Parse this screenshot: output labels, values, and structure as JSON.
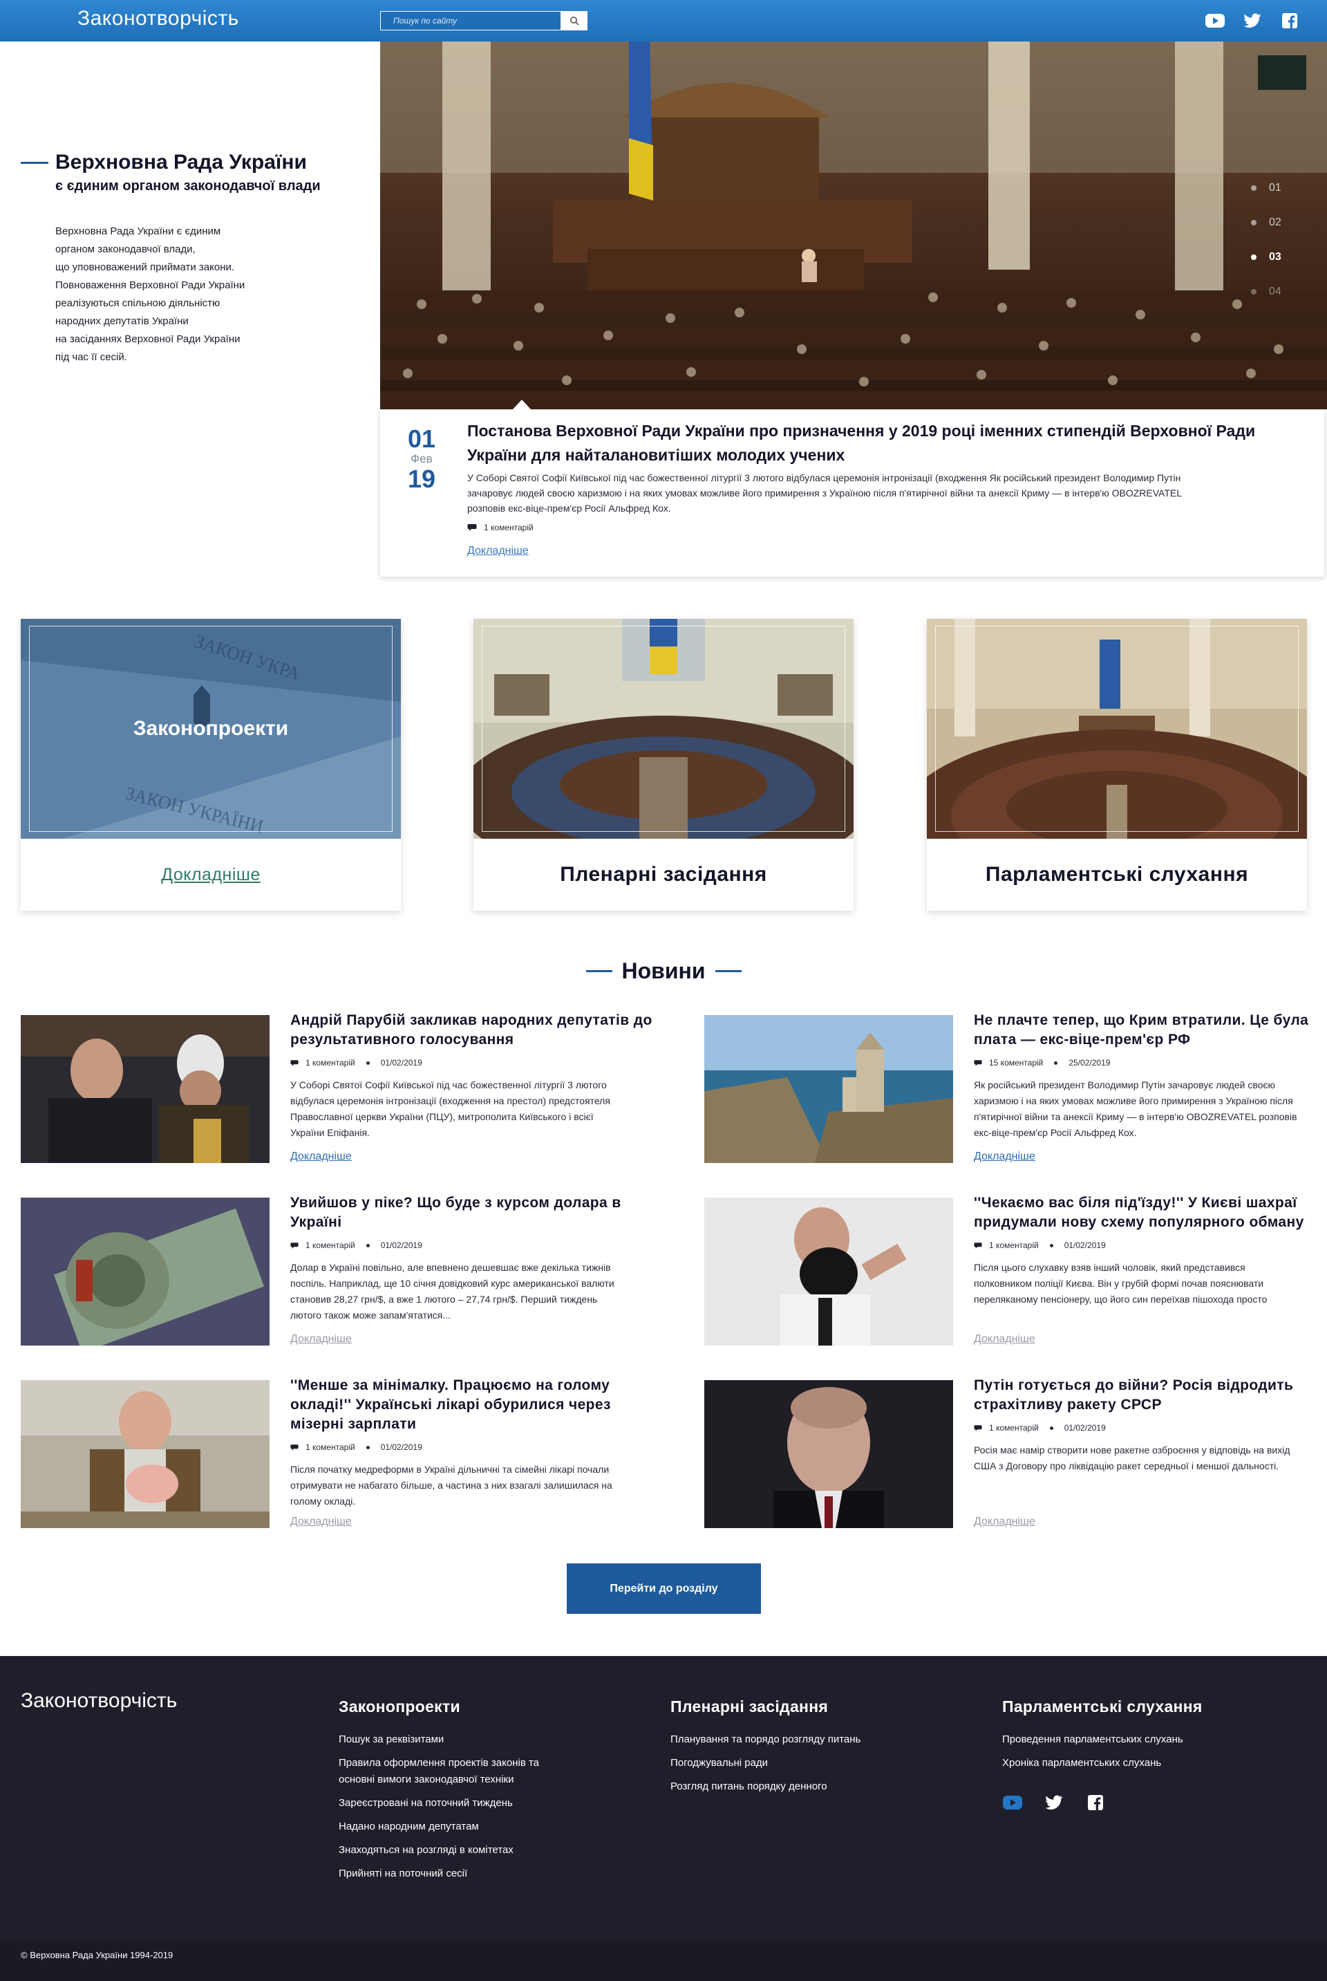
{
  "header": {
    "logo": "Законотворчість",
    "search_placeholder": "Пошук по сайту",
    "social": [
      "youtube-icon",
      "twitter-icon",
      "facebook-icon"
    ]
  },
  "hero": {
    "title": "Верхновна Рада України",
    "subtitle": "є єдиним органом законодавчої влади",
    "text_lines": [
      "Верхновна Рада України є єдиним",
      "органом законодавчої влади,",
      "що уповноважений приймати закони.",
      "Повноваження Верховної Ради України",
      "реалізуються спільною діяльністю",
      "народних депутатів України",
      "на засіданнях Верховної Ради України",
      "під час її сесій."
    ],
    "slider": [
      "01",
      "02",
      "03",
      "04"
    ],
    "slider_active": 2
  },
  "featured": {
    "day": "01",
    "month": "Фев",
    "year": "19",
    "title": "Постанова Верховної Ради України про призначення у 2019 році іменних стипендій Верховної Ради України для найталановитіших молодих учених",
    "excerpt": "У Соборі Святої Софії Київської під час божественної літургії 3 лютого відбулася церемонія інтронізації (входження Як російський президент Володимир Путін зачаровує людей своєю харизмою і на яких умовах можливе його примирення з Україною після п'ятирічної війни та анексії Криму — в інтерв'ю OBOZREVATEL розповів екс-віце-прем'єр Росії Альфред Кох.",
    "comments": "1 коментарій",
    "more": "Докладніше"
  },
  "categories": [
    {
      "label": "Законопроекти",
      "more": "Докладніше"
    },
    {
      "label": "Пленарні засідання"
    },
    {
      "label": "Парламентські слухання"
    }
  ],
  "news_heading": "Новини",
  "news": [
    {
      "title": "Андрій Парубій закликав народних депутатів до результативного голосування",
      "comments": "1 коментарій",
      "date": "01/02/2019",
      "text": "У Соборі Святої Софії Київської під час божественної літургії 3 лютого відбулася церемонія інтронізації (входження на престол) предстоятеля Православної церкви України (ПЦУ), митрополита Київського і всієї України Епіфанія.",
      "more": "Докладніше"
    },
    {
      "title": "Не плачте тепер, що Крим втратили. Це була плата — екс-віце-прем'єр РФ",
      "comments": "15 коментарій",
      "date": "25/02/2019",
      "text": "Як російський президент Володимир Путін зачаровує людей своєю харизмою і на яких умовах можливе його примирення з Україною після п'ятирічної війни та анексії Криму — в інтерв'ю OBOZREVATEL розповів екс-віце-прем'єр Росії Альфред Кох.",
      "more": "Докладніше"
    },
    {
      "title": "Увийшов у піке? Що буде з курсом долара в Україні",
      "comments": "1 коментарій",
      "date": "01/02/2019",
      "text": "Долар в Україні повільно, але впевнено дешевшає вже декілька тижнів поспіль. Наприклад, ще 10 січня довідковий курс американської валюти становив 28,27 грн/$, а вже 1 лютого – 27,74 грн/$. Перший тиждень лютого також може запам'ятатися...",
      "more": "Докладніше"
    },
    {
      "title": "''Чекаємо вас біля під'їзду!'' У Києві шахраї придумали нову схему популярного обману",
      "comments": "1 коментарій",
      "date": "01/02/2019",
      "text": "Після цього слухавку взяв інший чоловік, який представився полковником поліції Києва. Він у грубій формі почав пояснювати переляканому пенсіонеру, що його син переїхав пішохода просто",
      "more": "Докладніше"
    },
    {
      "title": "''Менше за мінімалку. Працюємо на голому окладі!'' Українські лікарі обурилися через мізерні зарплати",
      "comments": "1 коментарій",
      "date": "01/02/2019",
      "text": "Після початку медреформи в Україні дільничні та сімейні лікарі почали отримувати не набагато більше, а частина з них взагалі залишилася на голому окладі.",
      "more": "Докладніше"
    },
    {
      "title": "Путін готується до війни? Росія відродить страхітливу ракету СРСР",
      "comments": "1 коментарій",
      "date": "01/02/2019",
      "text": "Росія має намір створити нове ракетне озброєння у відповідь на вихід США з Договору про ліквідацію ракет середньої і меншої дальності.",
      "more": "Докладніше"
    }
  ],
  "go_button": "Перейти до розділу",
  "footer": {
    "logo": "Законотворчість",
    "columns": [
      {
        "title": "Законопроекти",
        "links": [
          "Пошук за реквізитами",
          "Правила оформлення проектів законів та основні вимоги законодавчої техніки",
          "Зареєстровані на поточний тиждень",
          "Надано народним депутатам",
          "Знаходяться на розгляді в комітетах",
          "Прийняті на поточний сесії"
        ]
      },
      {
        "title": "Пленарні засідання",
        "links": [
          "Планування та порядо розгляду питань",
          "Погоджувальні ради",
          "Розгляд питань порядку денного"
        ]
      },
      {
        "title": "Парламентські слухання",
        "links": [
          "Проведення парламентських слухань",
          "Хроніка парламентських слухань"
        ]
      }
    ],
    "copyright": "© Верховна Рада України 1994-2019"
  },
  "colors": {
    "header_blue": "#2477c4",
    "accent": "#1f5a9c",
    "footer_bg": "#1f1f2b",
    "link_blue": "#2e6bb1"
  }
}
